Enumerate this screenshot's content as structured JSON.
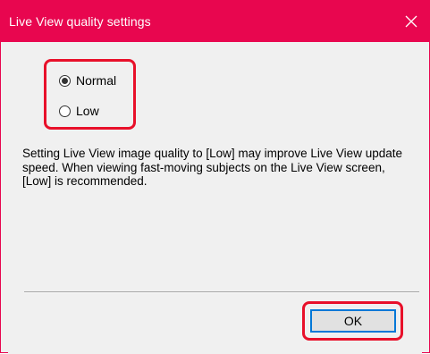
{
  "dialog": {
    "title": "Live View quality settings",
    "close_icon": "close-icon"
  },
  "quality": {
    "selected": "Normal",
    "options": [
      {
        "label": "Normal",
        "checked": true
      },
      {
        "label": "Low",
        "checked": false
      }
    ]
  },
  "description": "Setting Live View image quality to [Low] may improve Live View update speed. When viewing fast-moving subjects on the Live View screen, [Low] is recommended.",
  "buttons": {
    "ok_label": "OK"
  },
  "colors": {
    "titlebar": "#e8064f",
    "highlight": "#e8102a",
    "focus_border": "#0078d7"
  }
}
